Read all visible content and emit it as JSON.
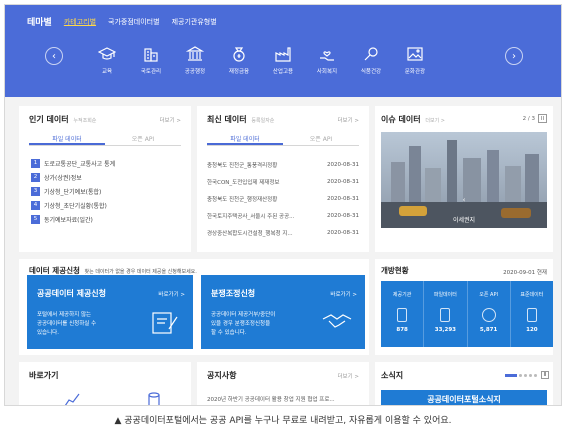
{
  "top_tabs": [
    "테마별",
    "카테고리별",
    "국가중점데이터별",
    "제공기관유형별"
  ],
  "categories": [
    {
      "label": "교육",
      "icon": "graduation-cap"
    },
    {
      "label": "국토관리",
      "icon": "building"
    },
    {
      "label": "공공행정",
      "icon": "government-building"
    },
    {
      "label": "재정금융",
      "icon": "money-bag"
    },
    {
      "label": "산업고용",
      "icon": "factory"
    },
    {
      "label": "사회복지",
      "icon": "hand-heart"
    },
    {
      "label": "식품건강",
      "icon": "magnifier"
    },
    {
      "label": "문화관광",
      "icon": "picture"
    }
  ],
  "popular": {
    "title": "인기 데이터",
    "subtitle": "누적조회순",
    "more": "더보기 >",
    "tabs": [
      "파일 데이터",
      "오픈 API"
    ],
    "items": [
      {
        "rank": "1",
        "text": "도로교통공단_교통사고 통계"
      },
      {
        "rank": "2",
        "text": "상가(상권)정보"
      },
      {
        "rank": "3",
        "text": "기상청_단기예보(통합)"
      },
      {
        "rank": "4",
        "text": "기상청_초단기실황(통합)"
      },
      {
        "rank": "5",
        "text": "동기예보자료(일간)"
      }
    ]
  },
  "recent": {
    "title": "최신 데이터",
    "subtitle": "등록일자순",
    "more": "더보기 >",
    "tabs": [
      "파일 데이터",
      "오픈 API"
    ],
    "items": [
      {
        "text": "충청북도 진천군_통풍격리정황",
        "date": "2020-08-31"
      },
      {
        "text": "한국CON_도전입입제 제재정보",
        "date": "2020-08-31"
      },
      {
        "text": "충청북도 진천군_행정재산정황",
        "date": "2020-08-31"
      },
      {
        "text": "한국토지주택공사_서울시 주된 공공...",
        "date": "2020-08-31"
      },
      {
        "text": "경상중산복합도시건설청_행복청 지...",
        "date": "2020-08-31"
      }
    ]
  },
  "issue": {
    "title": "이슈 데이터",
    "more": "더보기 >",
    "pager": "2 / 3",
    "pause": "II",
    "caption": "이세권지"
  },
  "provide": {
    "title": "데이터 제공신청",
    "desc": "찾는 데이터가 없을 경우 데이터 제공을 신청해보세요.",
    "box1": {
      "title": "공공데이터 제공신청",
      "more": "바로가기 >",
      "lines": [
        "포털에서 제공하지 않는",
        "공공데이터를 신청하실 수",
        "있습니다."
      ]
    },
    "box2": {
      "title": "분쟁조정신청",
      "more": "바로가기 >",
      "lines": [
        "공공데이터 제공거부/중단이",
        "있을 경우 분쟁조정신청을",
        "할 수 있습니다."
      ]
    }
  },
  "status": {
    "title": "개방현황",
    "date": "2020-09-01 현재",
    "items": [
      {
        "label": "제공기관",
        "value": "878"
      },
      {
        "label": "파일데이터",
        "value": "33,293"
      },
      {
        "label": "오픈 API",
        "value": "5,871"
      },
      {
        "label": "표준데이터",
        "value": "120"
      }
    ]
  },
  "shortcuts": {
    "title": "바로가기"
  },
  "notice": {
    "title": "공지사항",
    "more": "더보기 >",
    "item": "2020년 하반기 공공데이터 활용 창업 지원 협업 프로..."
  },
  "news": {
    "title": "소식지",
    "banner": "공공데이터포털소식지"
  },
  "caption": "▲ 공공데이터포털에서는 공공 API를 누구나 무료로 내려받고, 자유롭게 이용할 수 있어요.",
  "colors": {
    "hero": "#4b6cd8",
    "accent": "#1f7bd4",
    "tab_active": "#ffd84a"
  }
}
